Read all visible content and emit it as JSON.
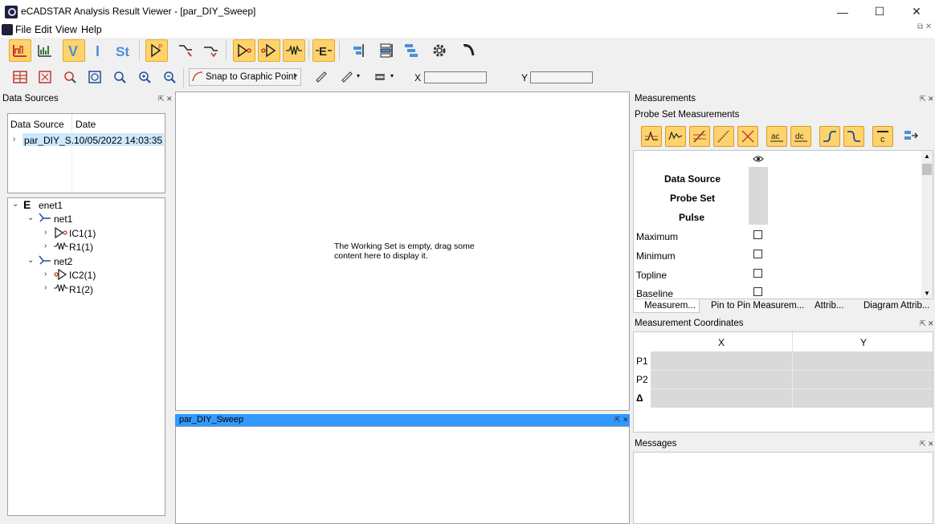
{
  "window": {
    "title": "eCADSTAR Analysis Result Viewer - [par_DIY_Sweep]",
    "minimize": "—",
    "maximize": "☐",
    "close": "✕"
  },
  "menu": [
    "File",
    "Edit",
    "View",
    "Help"
  ],
  "toolbar": {
    "snap_label": "Snap to Graphic Point",
    "x_label": "X",
    "y_label": "Y",
    "x_value": "",
    "y_value": ""
  },
  "data_sources": {
    "title": "Data Sources",
    "columns": [
      "Data Source",
      "Date"
    ],
    "rows": [
      {
        "name": "par_DIY_S...",
        "date": "10/05/2022 14:03:35"
      }
    ]
  },
  "tree": {
    "root": "enet1",
    "nets": [
      {
        "label": "net1",
        "children": [
          "IC1(1)",
          "R1(1)"
        ]
      },
      {
        "label": "net2",
        "children": [
          "IC2(1)",
          "R1(2)"
        ]
      }
    ]
  },
  "working_set": {
    "message_line1": "The Working Set is empty, drag some",
    "message_line2": "content here to display it."
  },
  "bottom_panel": {
    "title": "par_DIY_Sweep"
  },
  "measurements": {
    "title": "Measurements",
    "subtitle": "Probe Set Measurements",
    "bold_rows": [
      "Data Source",
      "Probe Set",
      "Pulse"
    ],
    "check_rows": [
      "Maximum",
      "Minimum",
      "Topline",
      "Baseline"
    ],
    "tabs": [
      "Measurem...",
      "Pin to Pin Measurem...",
      "Attrib...",
      "Diagram Attrib..."
    ]
  },
  "coordinates": {
    "title": "Measurement Coordinates",
    "columns": [
      "X",
      "Y"
    ],
    "rows": [
      "P1",
      "P2",
      "Δ"
    ]
  },
  "messages": {
    "title": "Messages"
  },
  "colors": {
    "accent_orange": "#ffd36b",
    "selection_blue": "#3399ff",
    "tree_selection": "#cce8ff"
  }
}
